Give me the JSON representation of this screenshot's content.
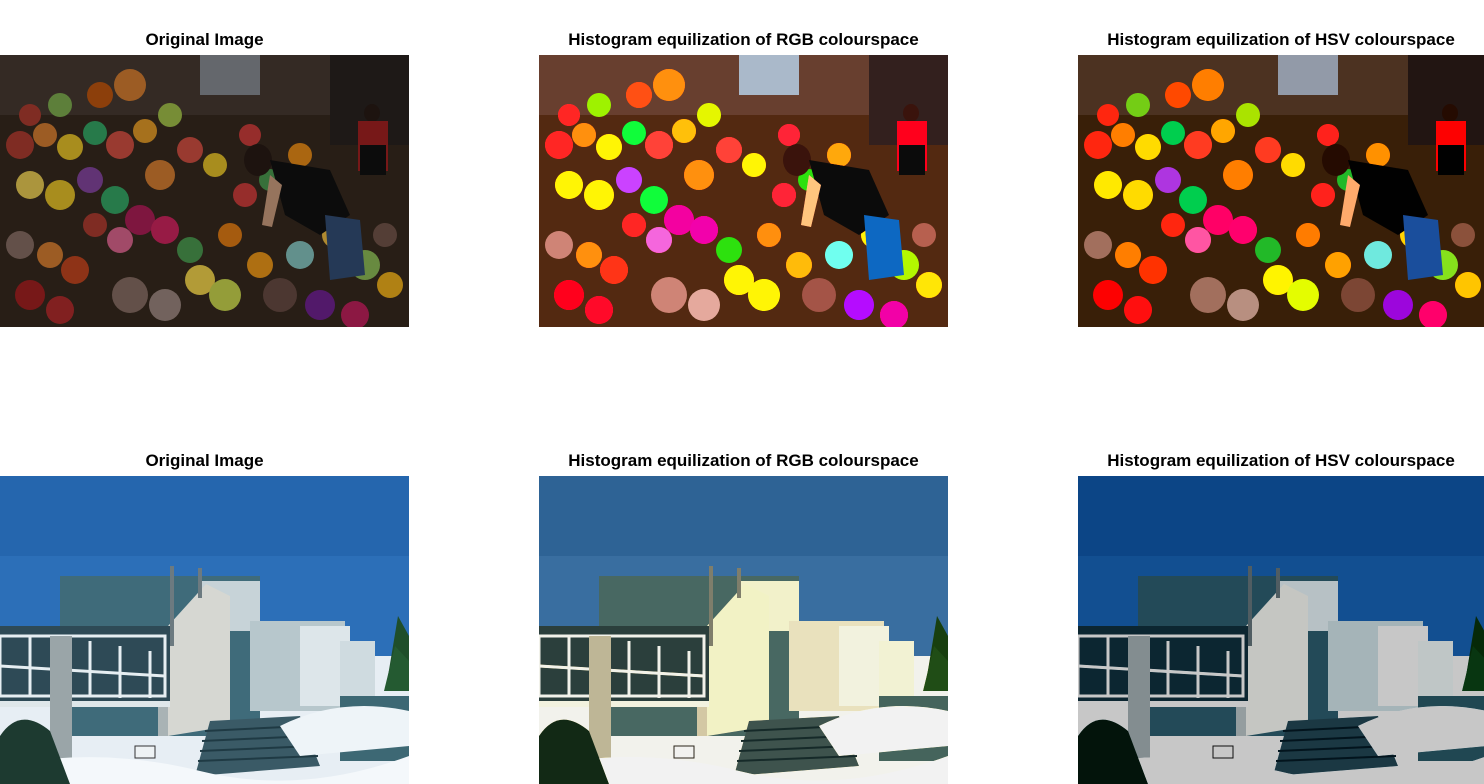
{
  "rows": [
    {
      "scene": "fruit-market",
      "panels": [
        {
          "title": "Original Image",
          "variant": "original"
        },
        {
          "title": "Histogram equilization of RGB colourspace",
          "variant": "rgb-equalized"
        },
        {
          "title": "Histogram equilization of HSV colourspace",
          "variant": "hsv-equalized"
        }
      ]
    },
    {
      "scene": "building-in-snow",
      "panels": [
        {
          "title": "Original Image",
          "variant": "original"
        },
        {
          "title": "Histogram equilization of RGB colourspace",
          "variant": "rgb-equalized"
        },
        {
          "title": "Histogram equilization of HSV colourspace",
          "variant": "hsv-equalized"
        }
      ]
    }
  ]
}
